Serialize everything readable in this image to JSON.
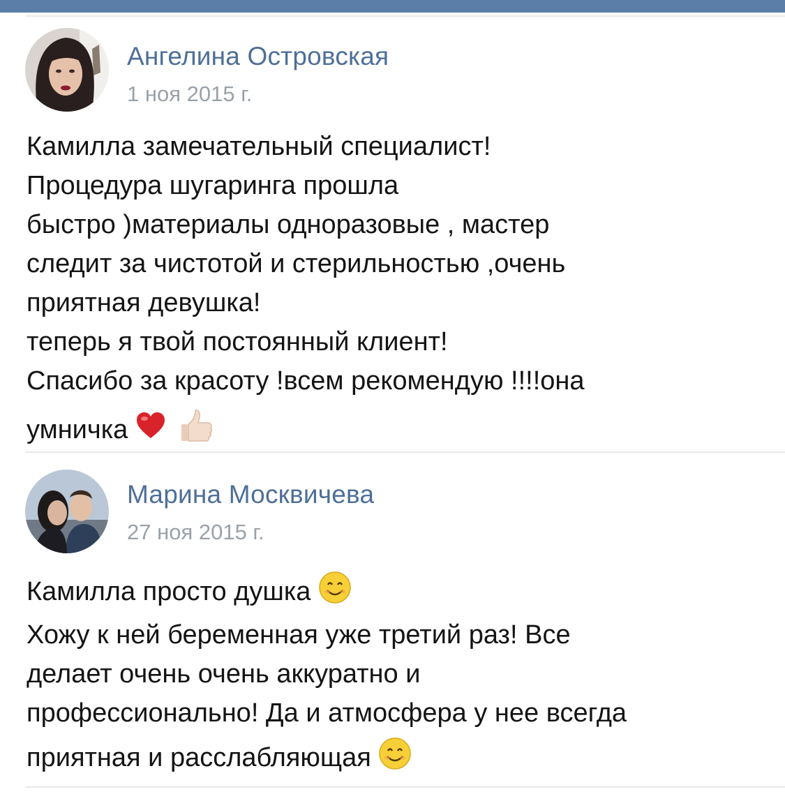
{
  "posts": [
    {
      "author": "Ангелина Островская",
      "date": "1 ноя 2015 г.",
      "lines": [
        "Камилла замечательный специалист!",
        "Процедура шугаринга прошла",
        "быстро )материалы одноразовые , мастер",
        "следит за чистотой и стерильностью ,очень",
        "приятная девушка!",
        "теперь я твой постоянный клиент!",
        "Спасибо за красоту !всем рекомендую !!!!она",
        "умничка"
      ],
      "emojis_end": [
        "heart-icon",
        "thumbs-up-icon"
      ]
    },
    {
      "author": "Марина Москвичева",
      "date": "27 ноя 2015 г.",
      "lines": [
        "Камилла просто душка",
        "Хожу к ней беременная уже третий раз! Все",
        "делает очень очень аккуратно и",
        "профессионально! Да и атмосфера у нее всегда",
        "приятная и расслабляющая"
      ],
      "emojis_inline": [
        "smile-icon",
        "smile-icon"
      ]
    }
  ],
  "colors": {
    "header_bar": "#5b7ea8",
    "author": "#4e6f98",
    "date": "#9aa1a8",
    "text": "#141414",
    "divider": "#e6e8eb"
  }
}
